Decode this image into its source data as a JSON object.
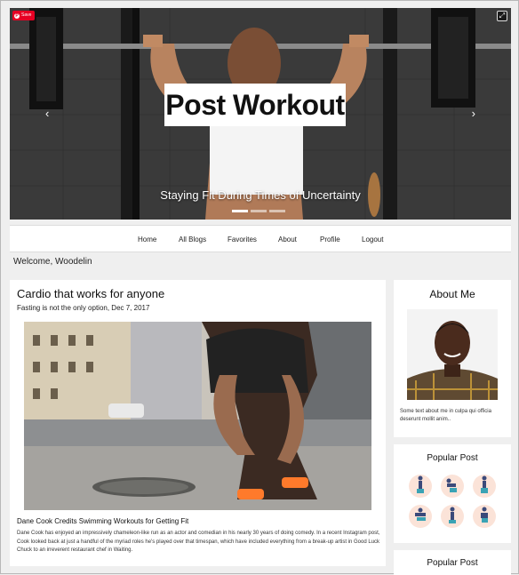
{
  "hero": {
    "pin_label": "Save",
    "title": "Post Workout",
    "subtitle": "Staying Fit During Times of Uncertainty",
    "prev_arrow": "‹",
    "next_arrow": "›",
    "expand_icon": "⤢",
    "slides": 3,
    "active_slide": 0
  },
  "nav": {
    "items": [
      "Home",
      "All Blogs",
      "Favorites",
      "About",
      "Profile",
      "Logout"
    ]
  },
  "welcome": "Welcome, Woodelin",
  "post": {
    "title": "Cardio that works for anyone",
    "meta": "Fasting is not the only option, Dec 7, 2017",
    "subheading": "Dane Cook Credits Swimming Workouts for Getting Fit",
    "body": "Dane Cook has enjoyed an impressively chameleon-like run as an actor and comedian in his nearly 30 years of doing comedy. In a recent Instagram post, Cook looked back at just a handful of the myriad roles he's played over that timespan, which have included everything from a break-up artist in Good Luck Chuck to an irreverent restaurant chef in Waiting."
  },
  "sidebar": {
    "about": {
      "heading": "About Me",
      "text": "Some text about me in culpa qui officia deserunt mollit anim.."
    },
    "popular": {
      "heading": "Popular Post"
    },
    "popular2": {
      "heading": "Popular Post"
    }
  },
  "colors": {
    "pinterest": "#e60023",
    "page_bg": "#efefef",
    "card_bg": "#ffffff"
  }
}
